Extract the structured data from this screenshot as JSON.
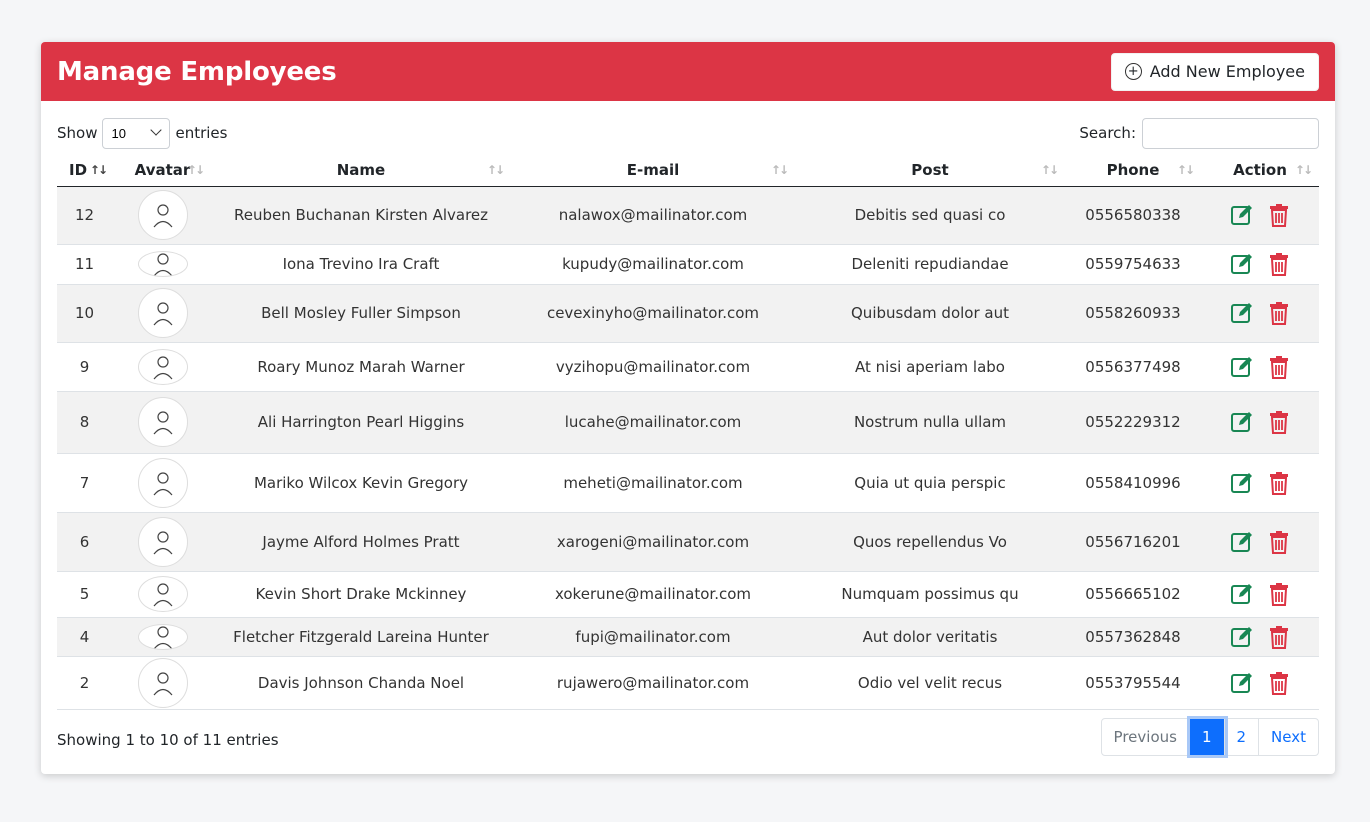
{
  "header": {
    "title": "Manage Employees",
    "add_button": "Add New Employee"
  },
  "controls": {
    "show_label": "Show",
    "entries_label": "entries",
    "length_value": "10",
    "search_label": "Search:"
  },
  "columns": [
    "ID",
    "Avatar",
    "Name",
    "E-mail",
    "Post",
    "Phone",
    "Action"
  ],
  "rows": [
    {
      "id": "12",
      "name": "Reuben Buchanan Kirsten Alvarez",
      "email": "nalawox@mailinator.com",
      "post": "Debitis sed quasi co",
      "phone": "0556580338"
    },
    {
      "id": "11",
      "name": "Iona Trevino Ira Craft",
      "email": "kupudy@mailinator.com",
      "post": "Deleniti repudiandae",
      "phone": "0559754633"
    },
    {
      "id": "10",
      "name": "Bell Mosley Fuller Simpson",
      "email": "cevexinyho@mailinator.com",
      "post": "Quibusdam dolor aut",
      "phone": "0558260933"
    },
    {
      "id": "9",
      "name": "Roary Munoz Marah Warner",
      "email": "vyzihopu@mailinator.com",
      "post": "At nisi aperiam labo",
      "phone": "0556377498"
    },
    {
      "id": "8",
      "name": "Ali Harrington Pearl Higgins",
      "email": "lucahe@mailinator.com",
      "post": "Nostrum nulla ullam",
      "phone": "0552229312"
    },
    {
      "id": "7",
      "name": "Mariko Wilcox Kevin Gregory",
      "email": "meheti@mailinator.com",
      "post": "Quia ut quia perspic",
      "phone": "0558410996"
    },
    {
      "id": "6",
      "name": "Jayme Alford Holmes Pratt",
      "email": "xarogeni@mailinator.com",
      "post": "Quos repellendus Vo",
      "phone": "0556716201"
    },
    {
      "id": "5",
      "name": "Kevin Short Drake Mckinney",
      "email": "xokerune@mailinator.com",
      "post": "Numquam possimus qu",
      "phone": "0556665102"
    },
    {
      "id": "4",
      "name": "Fletcher Fitzgerald Lareina Hunter",
      "email": "fupi@mailinator.com",
      "post": "Aut dolor veritatis",
      "phone": "0557362848"
    },
    {
      "id": "2",
      "name": "Davis Johnson Chanda Noel",
      "email": "rujawero@mailinator.com",
      "post": "Odio vel velit recus",
      "phone": "0553795544"
    }
  ],
  "footer": {
    "info": "Showing 1 to 10 of 11 entries",
    "prev": "Previous",
    "page1": "1",
    "page2": "2",
    "next": "Next"
  },
  "colors": {
    "header_bg": "#dc3545",
    "edit_icon": "#198754",
    "delete_icon": "#dc3545",
    "page_active": "#0d6efd"
  }
}
